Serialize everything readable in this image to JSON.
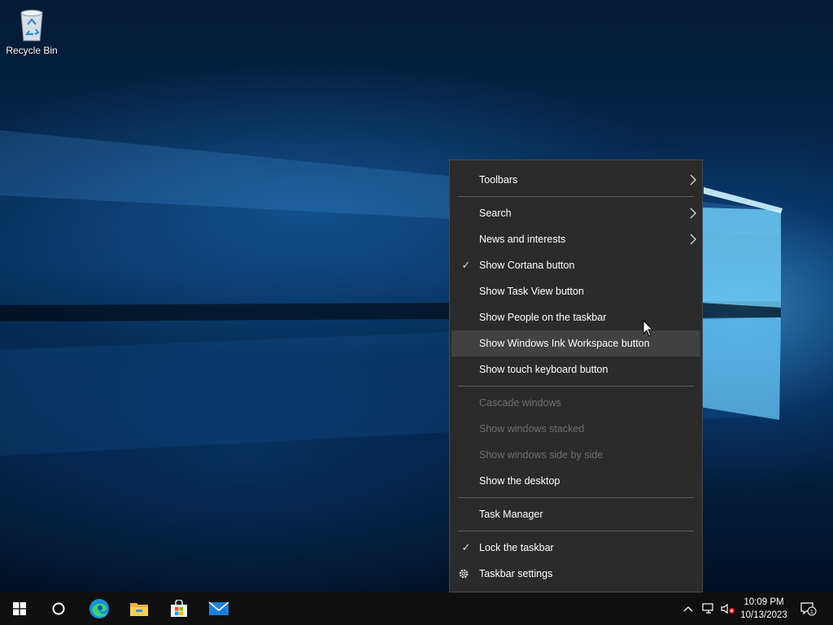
{
  "desktop": {
    "icons": [
      {
        "label": "Recycle Bin",
        "icon": "recycle-bin-icon"
      }
    ]
  },
  "context_menu": {
    "items": [
      {
        "label": "Toolbars",
        "submenu": true,
        "checked": false,
        "disabled": false
      },
      {
        "separator": true
      },
      {
        "label": "Search",
        "submenu": true,
        "checked": false,
        "disabled": false
      },
      {
        "label": "News and interests",
        "submenu": true,
        "checked": false,
        "disabled": false
      },
      {
        "label": "Show Cortana button",
        "submenu": false,
        "checked": true,
        "disabled": false
      },
      {
        "label": "Show Task View button",
        "submenu": false,
        "checked": false,
        "disabled": false
      },
      {
        "label": "Show People on the taskbar",
        "submenu": false,
        "checked": false,
        "disabled": false
      },
      {
        "label": "Show Windows Ink Workspace button",
        "submenu": false,
        "checked": false,
        "disabled": false,
        "highlighted": true
      },
      {
        "label": "Show touch keyboard button",
        "submenu": false,
        "checked": false,
        "disabled": false
      },
      {
        "separator": true
      },
      {
        "label": "Cascade windows",
        "submenu": false,
        "checked": false,
        "disabled": true
      },
      {
        "label": "Show windows stacked",
        "submenu": false,
        "checked": false,
        "disabled": true
      },
      {
        "label": "Show windows side by side",
        "submenu": false,
        "checked": false,
        "disabled": true
      },
      {
        "label": "Show the desktop",
        "submenu": false,
        "checked": false,
        "disabled": false
      },
      {
        "separator": true
      },
      {
        "label": "Task Manager",
        "submenu": false,
        "checked": false,
        "disabled": false
      },
      {
        "separator": true
      },
      {
        "label": "Lock the taskbar",
        "submenu": false,
        "checked": true,
        "disabled": false
      },
      {
        "label": "Taskbar settings",
        "submenu": false,
        "checked": false,
        "disabled": false,
        "icon": "gear-icon"
      }
    ]
  },
  "taskbar": {
    "pinned": [
      "start-icon",
      "cortana-icon",
      "edge-icon",
      "file-explorer-icon",
      "store-icon",
      "mail-icon"
    ],
    "tray_icons": [
      "chevron-up-icon",
      "network-icon",
      "volume-muted-icon"
    ],
    "time": "10:09 PM",
    "date": "10/13/2023",
    "notification_count": "1"
  },
  "colors": {
    "menu_bg": "#2b2b2b",
    "menu_hover": "#414141",
    "taskbar_bg": "#101010",
    "disabled_text": "#6f6f6f"
  }
}
